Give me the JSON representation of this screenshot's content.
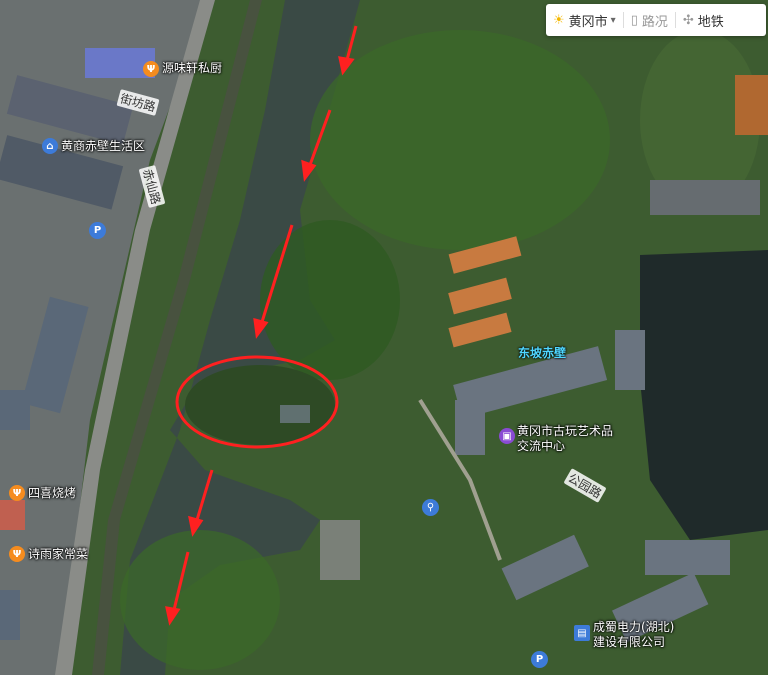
{
  "toolbar": {
    "city": "黄冈市",
    "traffic": "路况",
    "subway": "地铁"
  },
  "poi": {
    "restaurant1": "源味轩私厨",
    "community": "黄商赤壁生活区",
    "bbq": "四喜烧烤",
    "restaurant2": "诗雨家常菜",
    "art_center_line1": "黄冈市古玩艺术品",
    "art_center_line2": "交流中心",
    "company_line1": "成蜀电力(湖北)",
    "company_line2": "建设有限公司",
    "landmark": "东坡赤壁"
  },
  "roads": {
    "road1": "街坊路",
    "road2": "赤仙路",
    "road3": "公园路"
  },
  "colors": {
    "forest": "#2f5a22",
    "water": "#3a4a45",
    "dark_water": "#1f2a2a",
    "annotation": "#ff2020",
    "poi_orange": "#f58c1f",
    "poi_blue": "#3d7bd9",
    "poi_purple": "#8a4bd3",
    "landmark_label": "#4fd7ff"
  },
  "icons": [
    "sun-icon",
    "traffic-icon",
    "subway-icon",
    "restaurant-icon",
    "community-icon",
    "parking-icon",
    "toilet-icon",
    "art-center-icon",
    "company-icon"
  ]
}
